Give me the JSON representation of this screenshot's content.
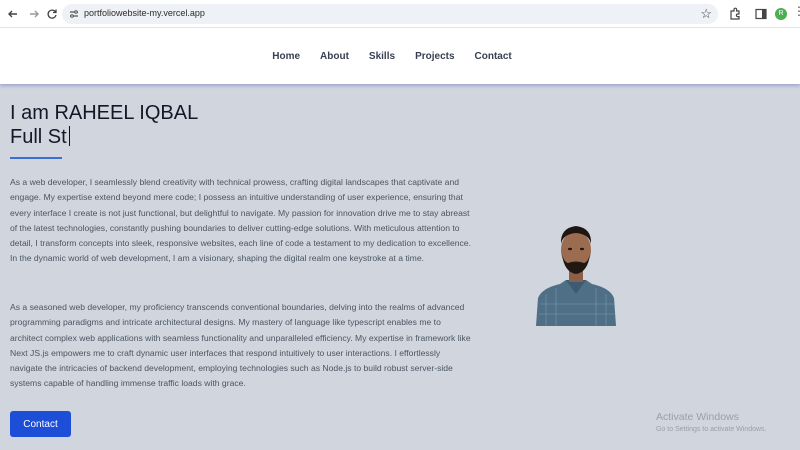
{
  "browser": {
    "url": "portfoliowebsite-my.vercel.app",
    "profile_initial": "R"
  },
  "nav": {
    "items": [
      {
        "label": "Home"
      },
      {
        "label": "About"
      },
      {
        "label": "Skills"
      },
      {
        "label": "Projects"
      },
      {
        "label": "Contact"
      }
    ]
  },
  "hero": {
    "title_line1": "I am RAHEEL IQBAL",
    "title_line2": "Full St",
    "paragraph1": "As a web developer, I seamlessly blend creativity with technical prowess, crafting digital landscapes that captivate and engage. My expertise extend beyond mere code; I possess an intuitive understanding of user experience, ensuring that every interface I create is not just functional, but delightful to navigate. My passion for innovation drive me to stay abreast of the latest technologies, constantly pushing boundaries to deliver cutting-edge solutions. With meticulous attention to detail, I transform concepts into sleek, responsive websites, each line of code a testament to my dedication to excellence. In the dynamic world of web development, I am a visionary, shaping the digital realm one keystroke at a time.",
    "paragraph2": "As a seasoned web developer, my proficiency transcends conventional boundaries, delving into the realms of advanced programming paradigms and intricate architectural designs. My mastery of language like typescript enables me to architect complex web applications with seamless functionality and unparalleled efficiency. My expertise in framework like Next JS.js empowers me to craft dynamic user interfaces that respond intuitively to user interactions. I effortlessly navigate the intricacies of backend development, employing technologies such as Node.js to build robust server-side systems capable of handling immense traffic loads with grace.",
    "contact_button": "Contact"
  },
  "watermark": {
    "title": "Activate Windows",
    "subtitle": "Go to Settings to activate Windows."
  },
  "colors": {
    "accent": "#1d4ed8",
    "underline": "#3b6fd6",
    "main_bg": "#d1d5dd"
  },
  "icons": [
    "back-arrow-icon",
    "forward-arrow-icon",
    "reload-icon",
    "site-info-icon",
    "bookmark-star-icon",
    "extensions-icon",
    "side-panel-icon",
    "profile-avatar-icon",
    "menu-dots-icon"
  ]
}
